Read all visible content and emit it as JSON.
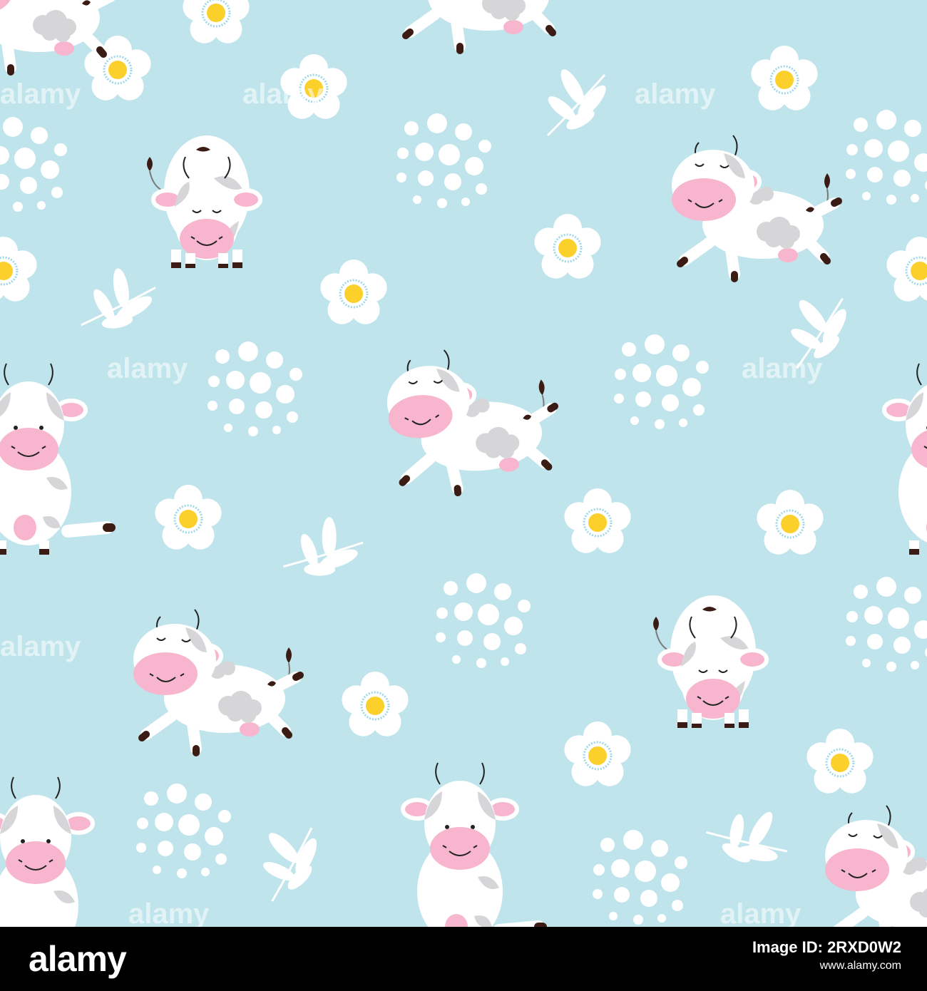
{
  "pattern": {
    "background_color": "#bfe4eb",
    "watermark_text": "alamy",
    "motifs": [
      "cow-icon",
      "daisy-icon",
      "leaf-icon",
      "dots-cluster-icon"
    ],
    "colors": {
      "cow_body": "#ffffff",
      "cow_spot": "#d6d6d8",
      "cow_muzzle": "#f7b6cd",
      "cow_hoof": "#3a1c14",
      "daisy_center": "#fbd02a",
      "daisy_ring": "#9fd7e8"
    }
  },
  "footer": {
    "logo": "alamy",
    "image_id_label": "Image ID: 2RXD0W2",
    "url": "www.alamy.com"
  }
}
